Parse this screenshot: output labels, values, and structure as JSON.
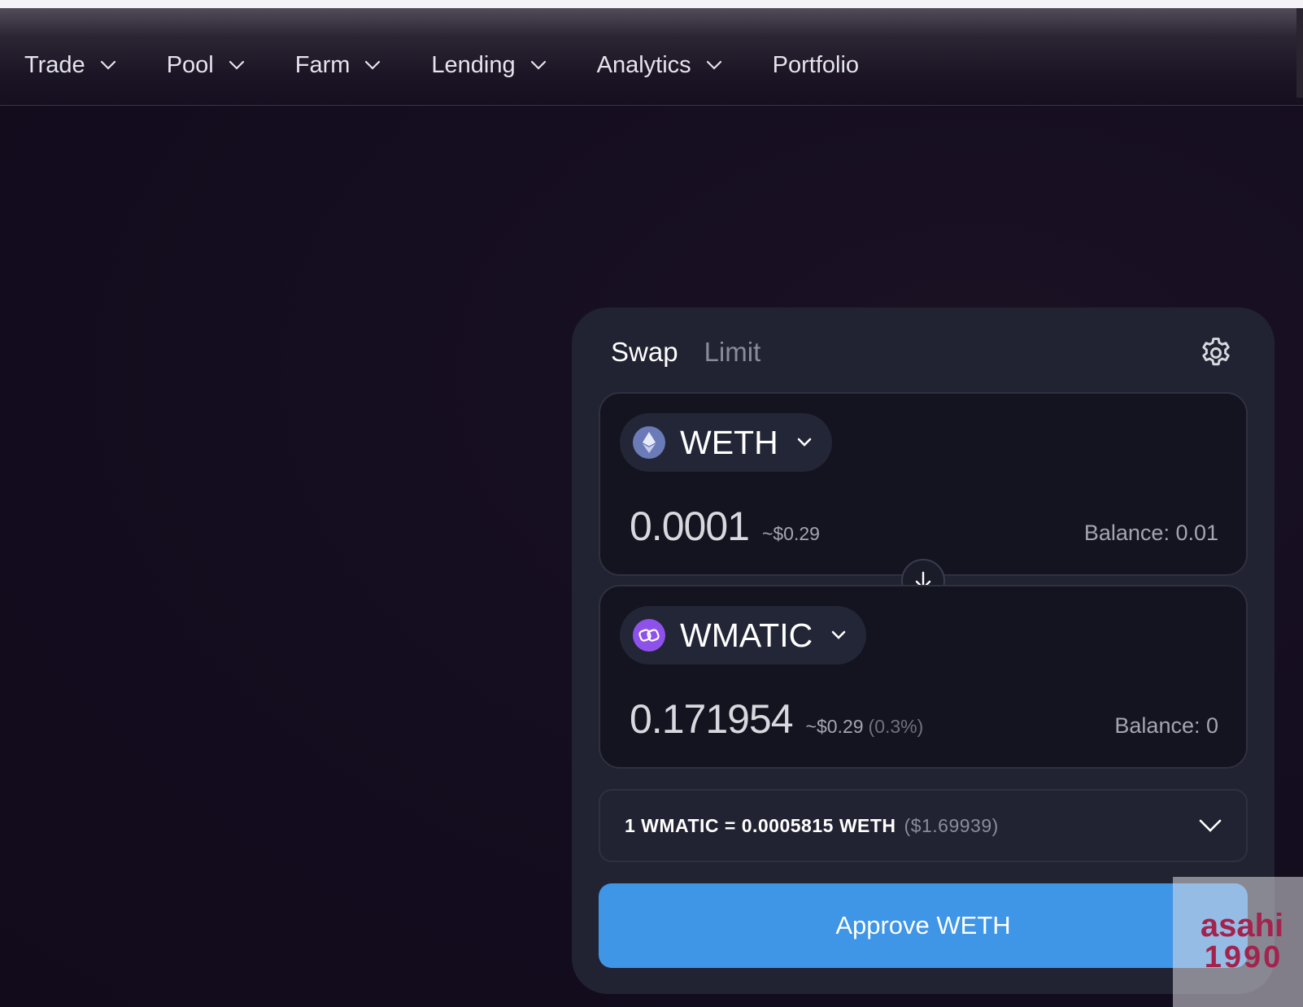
{
  "nav": {
    "items": [
      {
        "label": "Trade",
        "has_dropdown": true
      },
      {
        "label": "Pool",
        "has_dropdown": true
      },
      {
        "label": "Farm",
        "has_dropdown": true
      },
      {
        "label": "Lending",
        "has_dropdown": true
      },
      {
        "label": "Analytics",
        "has_dropdown": true
      },
      {
        "label": "Portfolio",
        "has_dropdown": false
      }
    ]
  },
  "swap": {
    "tabs": [
      {
        "label": "Swap",
        "active": true
      },
      {
        "label": "Limit",
        "active": false
      }
    ],
    "settings_icon": "gear-icon",
    "from": {
      "token": "WETH",
      "token_icon": "eth-icon",
      "amount": "0.0001",
      "usd": "~$0.29",
      "balance": "Balance: 0.01"
    },
    "switch_icon": "arrow-down-icon",
    "to": {
      "token": "WMATIC",
      "token_icon": "matic-icon",
      "amount": "0.171954",
      "usd": "~$0.29",
      "pct": "(0.3%)",
      "balance": "Balance: 0"
    },
    "rate": {
      "text": "1 WMATIC = 0.0005815 WETH",
      "usd": "($1.69939)"
    },
    "approve_label": "Approve WETH"
  },
  "watermark": {
    "line1": "asahi",
    "line2": "1990"
  },
  "colors": {
    "background": "#130d1f",
    "card": "#212332",
    "panel": "#141420",
    "accent_button": "#3f95e6",
    "eth_icon": "#6b7bb8",
    "matic_icon": "#8e52ea",
    "watermark_text": "#a3234d"
  }
}
